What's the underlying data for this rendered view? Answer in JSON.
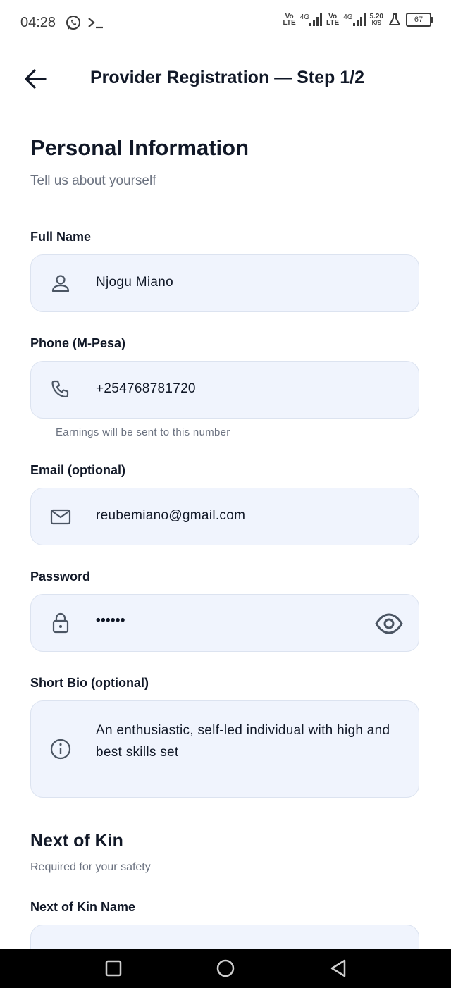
{
  "status_bar": {
    "time": "04:28",
    "net1_top": "Vo",
    "net1_bottom": "LTE",
    "net1_gen": "4G",
    "net2_top": "Vo",
    "net2_bottom": "LTE",
    "net2_gen": "4G",
    "speed": "5.20",
    "speed_unit": "K/S",
    "battery": "67"
  },
  "header": {
    "title": "Provider Registration — Step 1/2"
  },
  "personal": {
    "title": "Personal Information",
    "subtitle": "Tell us about yourself"
  },
  "fields": {
    "full_name": {
      "label": "Full Name",
      "value": "Njogu Miano",
      "icon": "person-icon"
    },
    "phone": {
      "label": "Phone (M-Pesa)",
      "value": "+254768781720",
      "icon": "phone-icon",
      "helper": "Earnings will be sent to this number"
    },
    "email": {
      "label": "Email (optional)",
      "value": "reubemiano@gmail.com",
      "icon": "mail-icon"
    },
    "password": {
      "label": "Password",
      "value": "••••••",
      "icon": "lock-icon"
    },
    "bio": {
      "label": "Short Bio (optional)",
      "value": "An enthusiastic, self-led individual with high and best skills set",
      "icon": "info-icon"
    }
  },
  "kin": {
    "title": "Next of Kin",
    "subtitle": "Required for your safety",
    "name_label": "Next of Kin Name"
  }
}
